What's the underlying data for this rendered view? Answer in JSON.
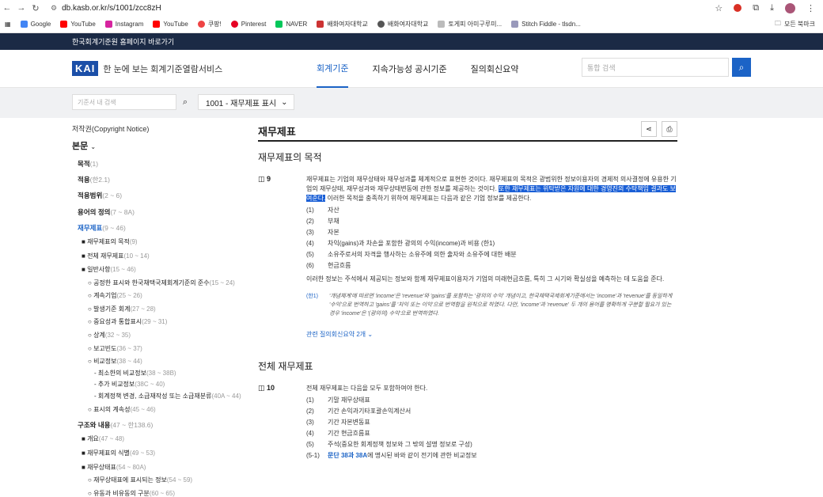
{
  "browser": {
    "url": "db.kasb.or.kr/s/1001/zcc8zH",
    "bookmarks": [
      "Google",
      "YouTube",
      "Instagram",
      "YouTube",
      "쿠팡!",
      "Pinterest",
      "NAVER",
      "배화여자대학교",
      "배화여자대학교",
      "토게피 아미구루미...",
      "Stitch Fiddle - tlsdn..."
    ],
    "all_bookmarks": "모든 북마크"
  },
  "topstrip": {
    "label": "한국회계기준원 홈페이지 바로가기"
  },
  "header": {
    "logo": "KAI",
    "service": "한 눈에 보는 회계기준열람서비스",
    "nav": [
      "회계기준",
      "지속가능성 공시기준",
      "질의회신요약"
    ],
    "search_placeholder": "통합 검색"
  },
  "subbar": {
    "doc_search_placeholder": "기준서 내 검색",
    "standard": "1001 - 재무제표 표시"
  },
  "sidebar": {
    "copyright": "저작권(Copyright Notice)",
    "body": "본문",
    "items": [
      {
        "t": "목적",
        "r": "(1)",
        "lvl": 1
      },
      {
        "t": "적용",
        "r": "(한2.1)",
        "lvl": 1
      },
      {
        "t": "적용범위",
        "r": "(2 ~ 6)",
        "lvl": 1
      },
      {
        "t": "용어의 정의",
        "r": "(7 ~ 8A)",
        "lvl": 1
      },
      {
        "t": "재무제표",
        "r": "(9 ~ 46)",
        "lvl": 1,
        "active": true
      },
      {
        "t": "재무제표의 목적",
        "r": "(9)",
        "lvl": 2
      },
      {
        "t": "전체 재무제표",
        "r": "(10 ~ 14)",
        "lvl": 2
      },
      {
        "t": "일반사항",
        "r": "(15 ~ 46)",
        "lvl": 2
      },
      {
        "t": "공정한 표시와 한국채택국제회계기준의 준수",
        "r": "(15 ~ 24)",
        "lvl": 3
      },
      {
        "t": "계속기업",
        "r": "(25 ~ 26)",
        "lvl": 3
      },
      {
        "t": "발생기준 회계",
        "r": "(27 ~ 28)",
        "lvl": 3
      },
      {
        "t": "중요성과 통합표시",
        "r": "(29 ~ 31)",
        "lvl": 3
      },
      {
        "t": "상계",
        "r": "(32 ~ 35)",
        "lvl": 3
      },
      {
        "t": "보고빈도",
        "r": "(36 ~ 37)",
        "lvl": 3
      },
      {
        "t": "비교정보",
        "r": "(38 ~ 44)",
        "lvl": 3
      },
      {
        "t": "최소한의 비교정보",
        "r": "(38 ~ 38B)",
        "lvl": 4
      },
      {
        "t": "추가 비교정보",
        "r": "(38C ~ 40)",
        "lvl": 4
      },
      {
        "t": "회계정책 변경, 소급재작성 또는 소급재분류",
        "r": "(40A ~ 44)",
        "lvl": 4
      },
      {
        "t": "표시의 계속성",
        "r": "(45 ~ 46)",
        "lvl": 3
      },
      {
        "t": "구조와 내용",
        "r": "(47 ~ 한138.6)",
        "lvl": 1
      },
      {
        "t": "개요",
        "r": "(47 ~ 48)",
        "lvl": 2
      },
      {
        "t": "재무제표의 식별",
        "r": "(49 ~ 53)",
        "lvl": 2
      },
      {
        "t": "재무상태표",
        "r": "(54 ~ 80A)",
        "lvl": 2
      },
      {
        "t": "재무상태표에 표시되는 정보",
        "r": "(54 ~ 59)",
        "lvl": 3
      },
      {
        "t": "유동과 비유동의 구분",
        "r": "(60 ~ 65)",
        "lvl": 3
      }
    ]
  },
  "content": {
    "title": "재무제표",
    "sub": "재무제표의 목적",
    "p9": {
      "num": "9",
      "a": "재무제표는 기업의 재무상태와 재무성과를 체계적으로 표현한 것이다. 재무제표의 목적은 광범위한 정보이용자의 경제적 의사결정에 유용한 기업의 재무상태, 재무성과와 재무상태변동에 관한 정보를 제공하는 것이다. ",
      "hl": "또한 재무제표는 위탁받은 자원에 대한 경영진의 수탁책임 결과도 보여준다.",
      "b": " 이러한 목적을 충족하기 위하여 재무제표는 다음과 같은 기업 정보를 제공한다.",
      "items": [
        {
          "n": "(1)",
          "t": "자산"
        },
        {
          "n": "(2)",
          "t": "부채"
        },
        {
          "n": "(3)",
          "t": "자본"
        },
        {
          "n": "(4)",
          "t": "차익(gains)과 차손을 포함한 광의의 수익(income)과 비용 (한1)"
        },
        {
          "n": "(5)",
          "t": "소유주로서의 자격을 행사하는 소유주에 의한 출자와 소유주에 대한 배분"
        },
        {
          "n": "(6)",
          "t": "현금흐름"
        }
      ],
      "after": "이러한 정보는 주석에서 제공되는 정보와 함께 재무제표이용자가 기업의 미래현금흐름, 특히 그 시기와 확실성을 예측하는 데 도움을 준다.",
      "note_tag": "(한1)",
      "note": "'개념체계'에 따르면 'income'은 'revenue'와 'gains'를 포함하는 '광의의 수익' 개념이고, 한국채택국제회계기준에서는 'income'과 'revenue'를 동일하게 '수익'으로 번역하고 'gains'를 '차익 또는 이익'으로 번역함을 원칙으로 하였다. 다만, 'income'과 'revenue' 두 개의 용어를 명확하게 구분할 필요가 있는 경우 'income'은 '(광의의) 수익'으로 번역하였다.",
      "related": "관련 질의회신요약 2개"
    },
    "section2": "전체 재무제표",
    "p10": {
      "num": "10",
      "intro": "전체 재무제표는 다음을 모두 포함하여야 한다.",
      "items": [
        {
          "n": "(1)",
          "t": "기말 재무상태표"
        },
        {
          "n": "(2)",
          "t": "기간 손익과기타포괄손익계산서"
        },
        {
          "n": "(3)",
          "t": "기간 자본변동표"
        },
        {
          "n": "(4)",
          "t": "기간 현금흐름표"
        },
        {
          "n": "(5)",
          "t": "주석(중요한 회계정책 정보와 그 밖의 설명 정보로 구성)"
        }
      ],
      "last_n": "(5-1)",
      "last_link": "문단 38과 38A",
      "last_rest": "에 명시된 바와 같이 전기에 관한 비교정보"
    }
  }
}
